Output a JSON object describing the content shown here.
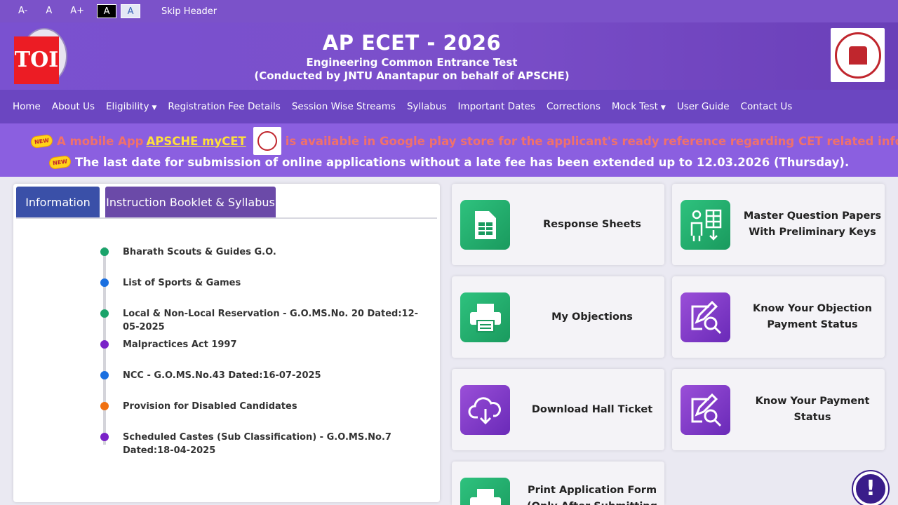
{
  "topbar": {
    "font_decrease": "A-",
    "font_normal": "A",
    "font_increase": "A+",
    "theme_dark": "A",
    "theme_light": "A",
    "skip_header": "Skip Header"
  },
  "header": {
    "badge": "TOI",
    "title": "AP ECET - 2026",
    "subtitle1": "Engineering Common Entrance Test",
    "subtitle2": "(Conducted by JNTU Anantapur on behalf of APSCHE)"
  },
  "nav": {
    "items": [
      "Home",
      "About Us",
      "Eligibility",
      "Registration Fee Details",
      "Session Wise Streams",
      "Syllabus",
      "Important Dates",
      "Corrections",
      "Mock Test",
      "User Guide",
      "Contact Us"
    ]
  },
  "announcements": {
    "new_badge": "NEW",
    "line1_pre": "A mobile App",
    "line1_app": "APSCHE myCET",
    "line1_post": "is available in Google play store for the applicant's ready reference regarding CET related info",
    "line2": "The last date for submission of online applications without a late fee has been extended up to 12.03.2026 (Thursday)."
  },
  "panel": {
    "tabs": [
      "Information",
      "Instruction Booklet & Syllabus"
    ],
    "items": [
      {
        "text": "Bharath Scouts & Guides G.O.",
        "color": "#1aa36a"
      },
      {
        "text": "List of Sports & Games",
        "color": "#1a6fe0"
      },
      {
        "text": "Local & Non-Local Reservation - G.O.MS.No. 20 Dated:12-05-2025",
        "color": "#1aa36a"
      },
      {
        "text": "Malpractices Act 1997",
        "color": "#7a22c8"
      },
      {
        "text": "NCC - G.O.MS.No.43 Dated:16-07-2025",
        "color": "#1a6fe0"
      },
      {
        "text": "Provision for Disabled Candidates",
        "color": "#f07010"
      },
      {
        "text": "Scheduled Castes (Sub Classification) - G.O.MS.No.7 Dated:18-04-2025",
        "color": "#7a22c8"
      }
    ]
  },
  "cards": {
    "response_sheets": "Response Sheets",
    "master_papers": "Master Question Papers With Preliminary Keys",
    "my_objections": "My Objections",
    "objection_payment": "Know Your Objection Payment Status",
    "hall_ticket": "Download Hall Ticket",
    "payment_status": "Know Your Payment Status",
    "print_form": "Print Application Form (Only After Submitting"
  },
  "help": "!",
  "colors": {
    "nav": "#6b46c1",
    "band": "#8b5fe0",
    "card_green": "#2ec27e",
    "card_purple": "#8a3fd0"
  }
}
